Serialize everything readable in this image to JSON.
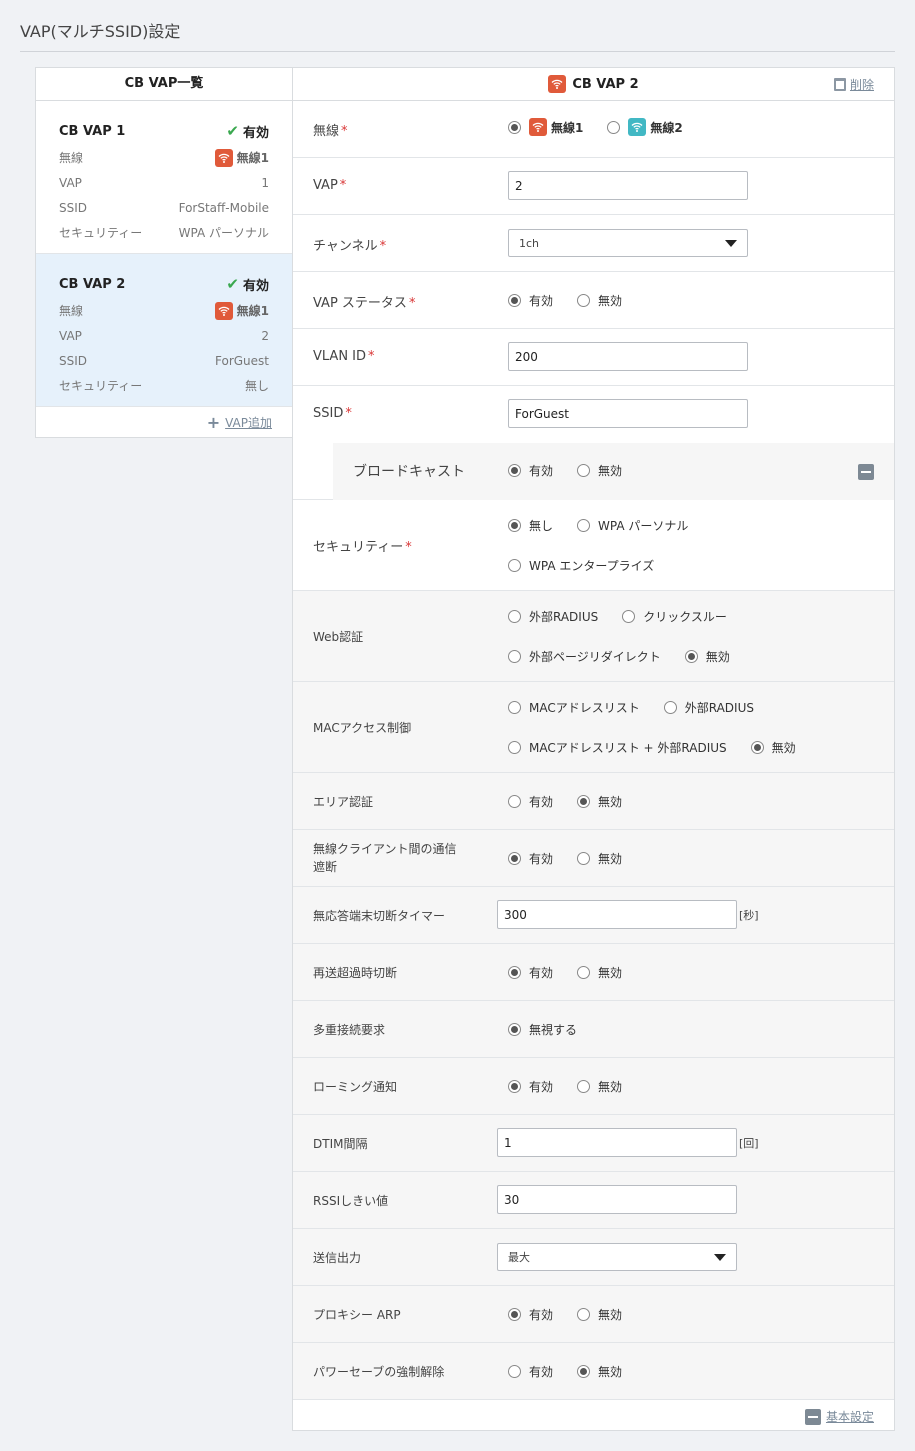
{
  "page": {
    "title": "VAP(マルチSSID)設定"
  },
  "list": {
    "header": "CB VAP一覧",
    "add_label": "VAP追加",
    "field_labels": {
      "radio": "無線",
      "vap": "VAP",
      "ssid": "SSID",
      "security": "セキュリティー"
    },
    "items": [
      {
        "name": "CB VAP 1",
        "status": "有効",
        "radio": "無線1",
        "vap": "1",
        "ssid": "ForStaff-Mobile",
        "security": "WPA パーソナル"
      },
      {
        "name": "CB VAP 2",
        "status": "有効",
        "radio": "無線1",
        "vap": "2",
        "ssid": "ForGuest",
        "security": "無し"
      }
    ]
  },
  "detail": {
    "title": "CB VAP 2",
    "delete_label": "削除",
    "footer_label": "基本設定",
    "req_mark": "*",
    "radio": {
      "label": "無線",
      "opt1": "無線1",
      "opt2": "無線2"
    },
    "vap": {
      "label": "VAP",
      "value": "2"
    },
    "channel": {
      "label": "チャンネル",
      "value": "1ch"
    },
    "vap_status": {
      "label": "VAP ステータス",
      "on": "有効",
      "off": "無効"
    },
    "vlan": {
      "label": "VLAN ID",
      "value": "200"
    },
    "ssid": {
      "label": "SSID",
      "value": "ForGuest"
    },
    "broadcast": {
      "label": "ブロードキャスト",
      "on": "有効",
      "off": "無効"
    },
    "security": {
      "label": "セキュリティー",
      "opt1": "無し",
      "opt2": "WPA パーソナル",
      "opt3": "WPA エンタープライズ"
    },
    "web_auth": {
      "label": "Web認証",
      "opt1": "外部RADIUS",
      "opt2": "クリックスルー",
      "opt3": "外部ページリダイレクト",
      "opt4": "無効"
    },
    "mac": {
      "label": "MACアクセス制御",
      "opt1": "MACアドレスリスト",
      "opt2": "外部RADIUS",
      "opt3": "MACアドレスリスト + 外部RADIUS",
      "opt4": "無効"
    },
    "area": {
      "label": "エリア認証",
      "on": "有効",
      "off": "無効"
    },
    "isolation": {
      "label1": "無線クライアント間の通信",
      "label2": "遮断",
      "on": "有効",
      "off": "無効"
    },
    "timer": {
      "label": "無応答端末切断タイマー",
      "value": "300",
      "unit": "[秒]"
    },
    "retrans": {
      "label": "再送超過時切断",
      "on": "有効",
      "off": "無効"
    },
    "multi": {
      "label": "多重接続要求",
      "opt1": "無視する"
    },
    "roaming": {
      "label": "ローミング通知",
      "on": "有効",
      "off": "無効"
    },
    "dtim": {
      "label": "DTIM間隔",
      "value": "1",
      "unit": "[回]"
    },
    "rssi": {
      "label": "RSSIしきい値",
      "value": "30"
    },
    "power": {
      "label": "送信出力",
      "value": "最大"
    },
    "proxy": {
      "label": "プロキシー ARP",
      "on": "有効",
      "off": "無効"
    },
    "psave": {
      "label": "パワーセーブの強制解除",
      "on": "有効",
      "off": "無効"
    }
  },
  "colors": {
    "radio1": "#e05a3a",
    "radio2": "#42b8c4",
    "selected_bg": "#e6f1fb",
    "enabled_check": "#3aa84f"
  }
}
